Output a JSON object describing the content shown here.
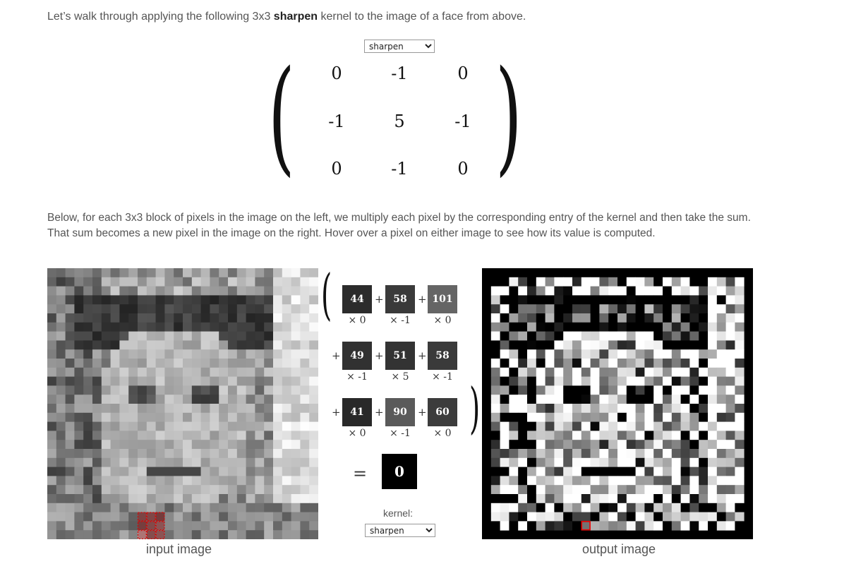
{
  "intro": {
    "pre": "Let’s walk through applying the following 3x3 ",
    "bold": "sharpen",
    "post": " kernel to the image of a face from above."
  },
  "kernel_select": {
    "selected": "sharpen"
  },
  "kernel": [
    [
      "0",
      "-1",
      "0"
    ],
    [
      "-1",
      "5",
      "-1"
    ],
    [
      "0",
      "-1",
      "0"
    ]
  ],
  "description": "Below, for each 3x3 block of pixels in the image on the left, we multiply each pixel by the corresponding entry of the kernel and then take the sum. That sum becomes a new pixel in the image on the right. Hover over a pixel on either image to see how its value is computed.",
  "calc": {
    "rows": [
      {
        "values": [
          "44",
          "58",
          "101"
        ],
        "multipliers": [
          "× 0",
          "× -1",
          "× 0"
        ]
      },
      {
        "values": [
          "49",
          "51",
          "58"
        ],
        "multipliers": [
          "× -1",
          "× 5",
          "× -1"
        ]
      },
      {
        "values": [
          "41",
          "90",
          "60"
        ],
        "multipliers": [
          "× 0",
          "× -1",
          "× 0"
        ]
      }
    ],
    "plus": "+",
    "equals": "=",
    "result": "0"
  },
  "kernel_label": "kernel:",
  "bottom_select": {
    "selected": "sharpen"
  },
  "captions": {
    "input": "input image",
    "output": "output image"
  }
}
